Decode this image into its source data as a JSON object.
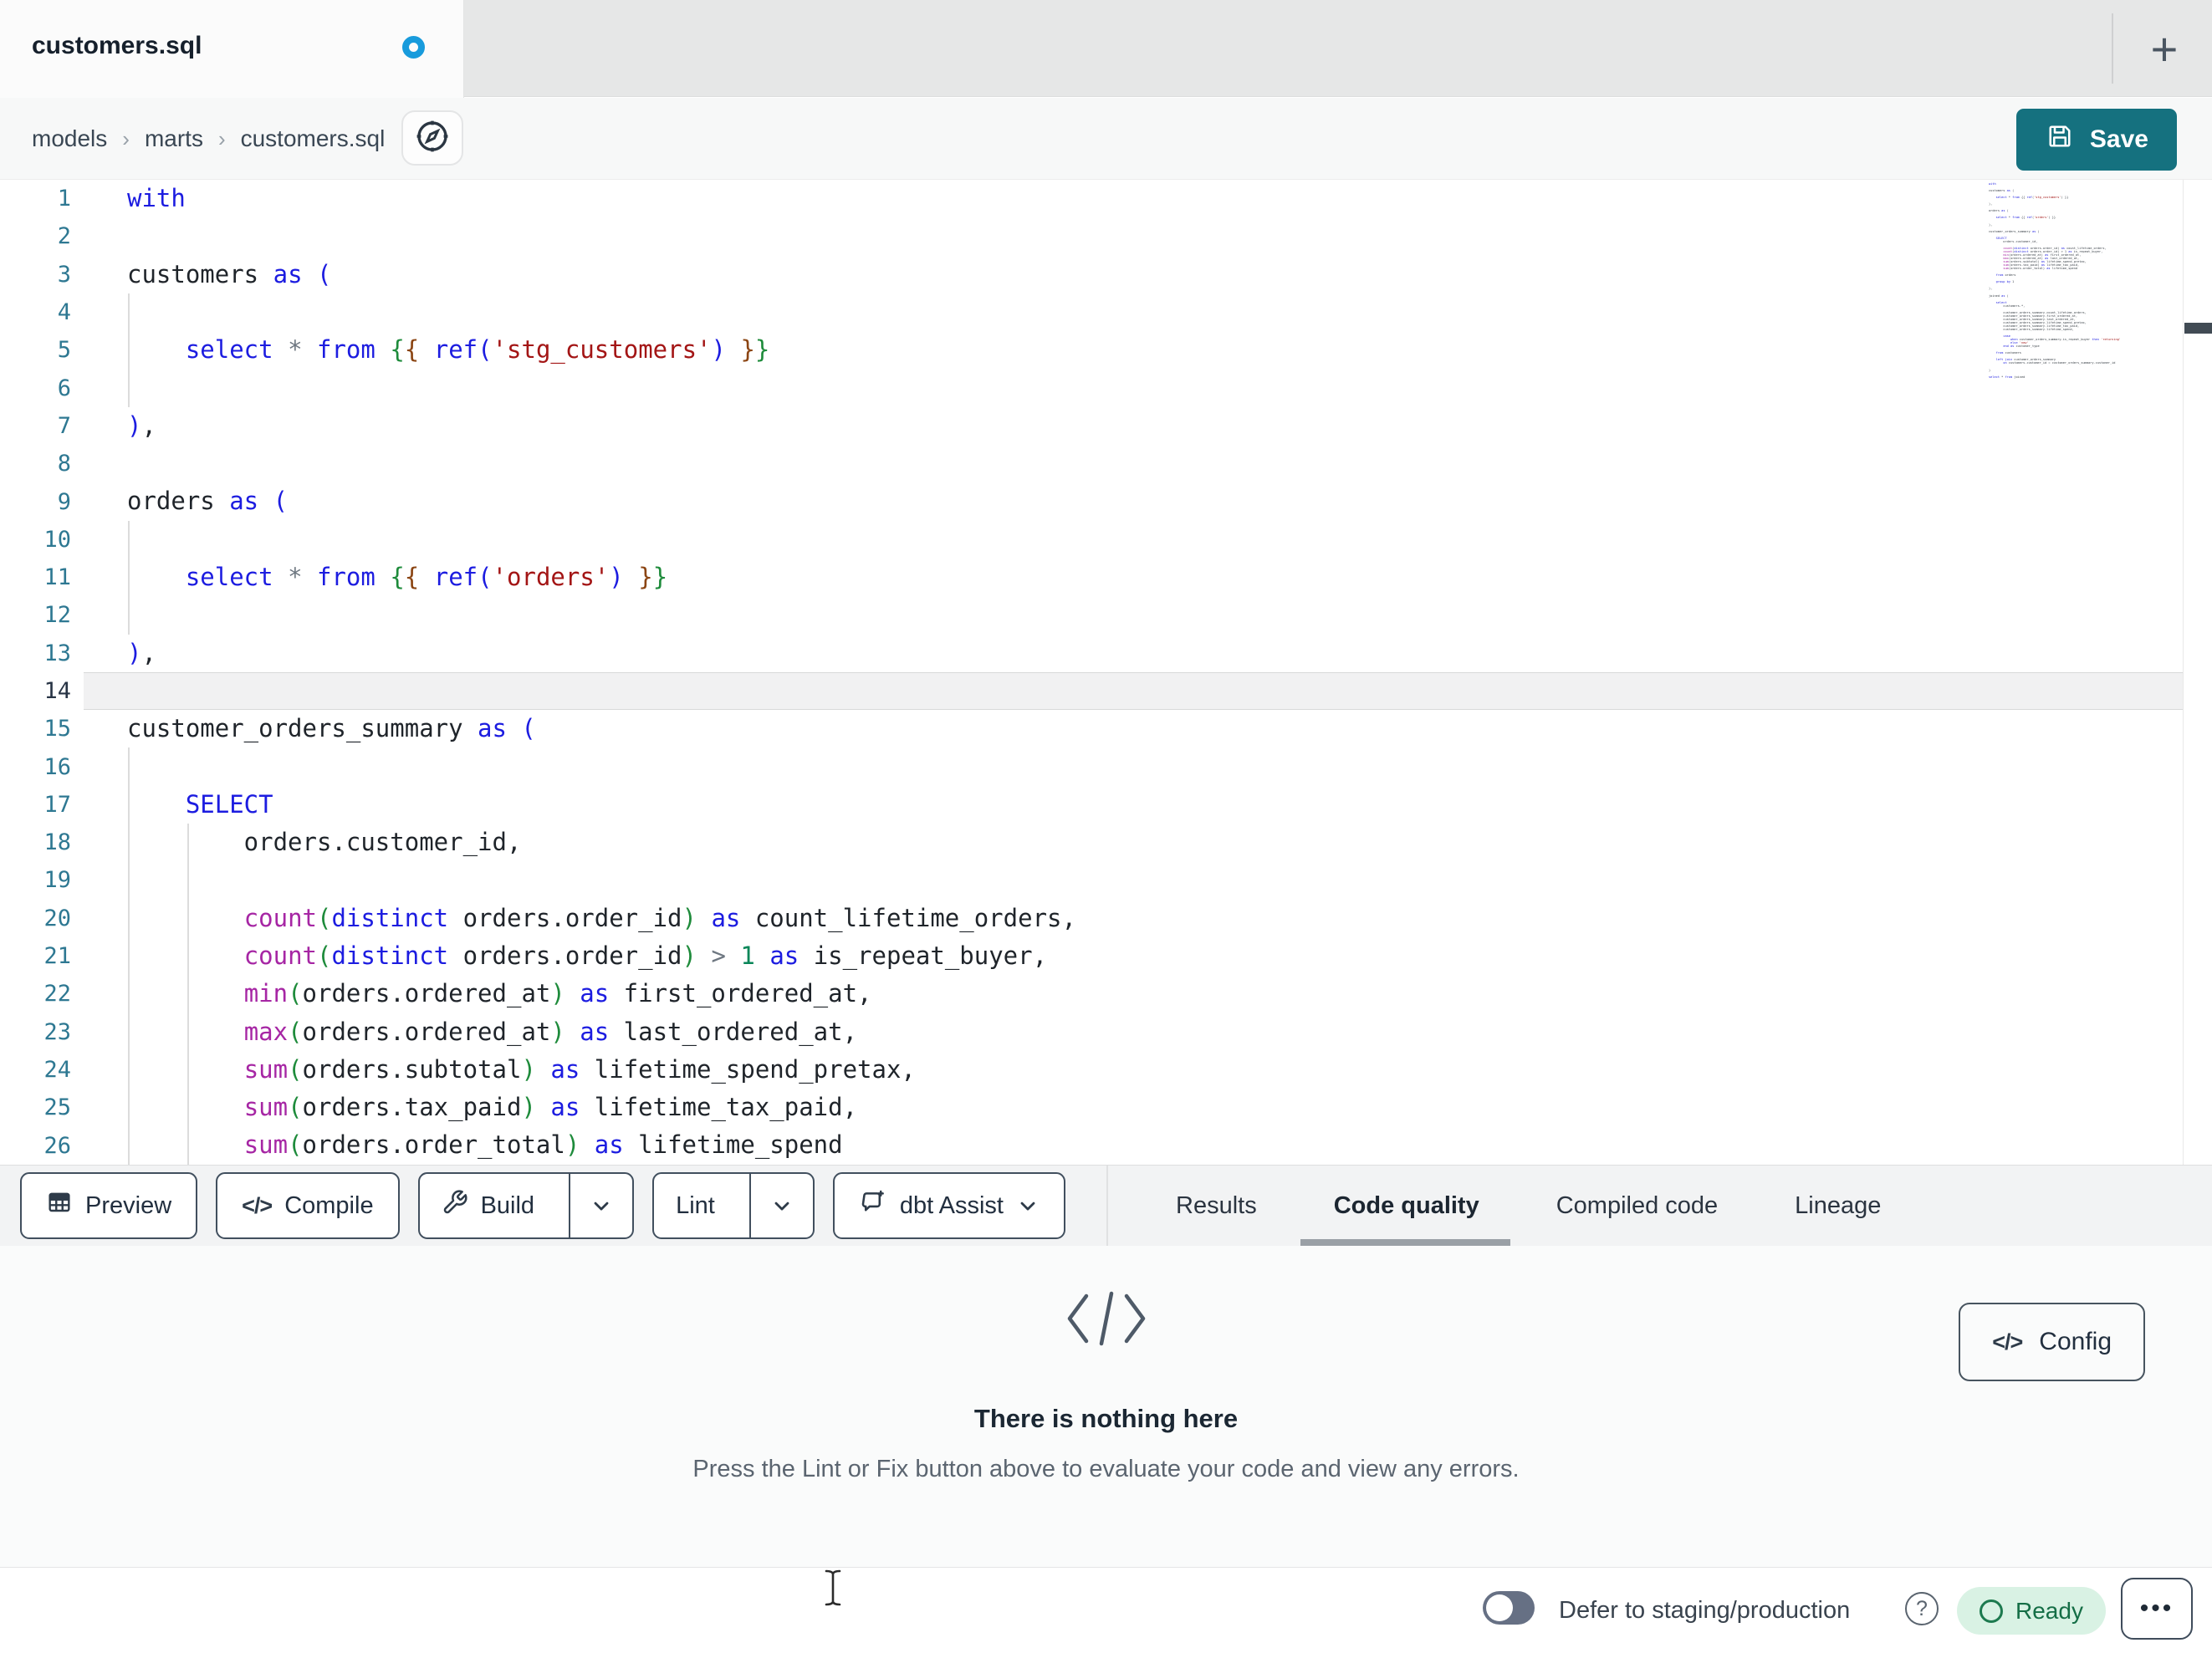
{
  "tab": {
    "title": "customers.sql",
    "unsaved_indicator": "unsaved-changes-dot"
  },
  "breadcrumb": {
    "items": [
      "models",
      "marts",
      "customers.sql"
    ],
    "separator": "›"
  },
  "save": {
    "label": "Save"
  },
  "icons": {
    "plus_glyph": "+",
    "help_glyph": "?",
    "more_glyph": "•••",
    "code_glyph": "</>",
    "save": "floppy-icon",
    "breadcrumb_action": "compass-icon",
    "preview": "table-grid-icon",
    "compile": "code-brackets-icon",
    "build": "wrench-icon",
    "assist": "chat-sparkle-icon",
    "dropdown": "chevron-down-icon",
    "empty_state": "code-brackets-icon",
    "ready": "circle-outline-icon",
    "pointer": "i-beam-cursor"
  },
  "colors": {
    "accent_teal": "#15717f",
    "unsaved_dot_blue": "#189bdc",
    "active_tab_underline": "#9aa0a6",
    "ready_badge_bg": "#d9f2e4",
    "ready_badge_text": "#156e46",
    "keyword_blue": "#1c1ce0",
    "function_magenta": "#a626a4",
    "string_red": "#a31515",
    "number_green": "#098658"
  },
  "editor": {
    "active_line": 14,
    "lines": [
      {
        "n": 1,
        "g": [],
        "t": [
          [
            "with",
            "kw"
          ]
        ]
      },
      {
        "n": 2,
        "g": [],
        "t": []
      },
      {
        "n": 3,
        "g": [],
        "t": [
          [
            "customers ",
            "id"
          ],
          [
            "as",
            "kw"
          ],
          [
            " ",
            "id"
          ],
          [
            "(",
            "b1"
          ]
        ]
      },
      {
        "n": 4,
        "g": [
          0
        ],
        "t": []
      },
      {
        "n": 5,
        "g": [
          0
        ],
        "t": [
          [
            "    ",
            "id"
          ],
          [
            "select",
            "kw"
          ],
          [
            " ",
            "id"
          ],
          [
            "*",
            "op"
          ],
          [
            " ",
            "id"
          ],
          [
            "from",
            "kw"
          ],
          [
            " ",
            "id"
          ],
          [
            "{",
            "bg"
          ],
          [
            "{",
            "bb"
          ],
          [
            " ",
            "id"
          ],
          [
            "ref",
            "kw"
          ],
          [
            "(",
            "b1"
          ],
          [
            "'stg_customers'",
            "str"
          ],
          [
            ")",
            "b1"
          ],
          [
            " ",
            "id"
          ],
          [
            "}",
            "bb"
          ],
          [
            "}",
            "bg"
          ]
        ]
      },
      {
        "n": 6,
        "g": [
          0
        ],
        "t": []
      },
      {
        "n": 7,
        "g": [],
        "t": [
          [
            ")",
            "b1"
          ],
          [
            ",",
            "id"
          ]
        ]
      },
      {
        "n": 8,
        "g": [],
        "t": []
      },
      {
        "n": 9,
        "g": [],
        "t": [
          [
            "orders ",
            "id"
          ],
          [
            "as",
            "kw"
          ],
          [
            " ",
            "id"
          ],
          [
            "(",
            "b1"
          ]
        ]
      },
      {
        "n": 10,
        "g": [
          0
        ],
        "t": []
      },
      {
        "n": 11,
        "g": [
          0
        ],
        "t": [
          [
            "    ",
            "id"
          ],
          [
            "select",
            "kw"
          ],
          [
            " ",
            "id"
          ],
          [
            "*",
            "op"
          ],
          [
            " ",
            "id"
          ],
          [
            "from",
            "kw"
          ],
          [
            " ",
            "id"
          ],
          [
            "{",
            "bg"
          ],
          [
            "{",
            "bb"
          ],
          [
            " ",
            "id"
          ],
          [
            "ref",
            "kw"
          ],
          [
            "(",
            "b1"
          ],
          [
            "'orders'",
            "str"
          ],
          [
            ")",
            "b1"
          ],
          [
            " ",
            "id"
          ],
          [
            "}",
            "bb"
          ],
          [
            "}",
            "bg"
          ]
        ]
      },
      {
        "n": 12,
        "g": [
          0
        ],
        "t": []
      },
      {
        "n": 13,
        "g": [],
        "t": [
          [
            ")",
            "b1"
          ],
          [
            ",",
            "id"
          ]
        ]
      },
      {
        "n": 14,
        "g": [],
        "t": []
      },
      {
        "n": 15,
        "g": [],
        "t": [
          [
            "customer_orders_summary ",
            "id"
          ],
          [
            "as",
            "kw"
          ],
          [
            " ",
            "id"
          ],
          [
            "(",
            "b1"
          ]
        ]
      },
      {
        "n": 16,
        "g": [
          0
        ],
        "t": []
      },
      {
        "n": 17,
        "g": [
          0
        ],
        "t": [
          [
            "    ",
            "id"
          ],
          [
            "SELECT",
            "kw"
          ]
        ]
      },
      {
        "n": 18,
        "g": [
          0,
          1
        ],
        "t": [
          [
            "        orders.customer_id,",
            "id"
          ]
        ]
      },
      {
        "n": 19,
        "g": [
          0,
          1
        ],
        "t": []
      },
      {
        "n": 20,
        "g": [
          0,
          1
        ],
        "t": [
          [
            "        ",
            "id"
          ],
          [
            "count",
            "fn"
          ],
          [
            "(",
            "bg"
          ],
          [
            "distinct",
            "kw"
          ],
          [
            " orders.order_id",
            "id"
          ],
          [
            ")",
            "bg"
          ],
          [
            " ",
            "id"
          ],
          [
            "as",
            "kw"
          ],
          [
            " count_lifetime_orders,",
            "id"
          ]
        ]
      },
      {
        "n": 21,
        "g": [
          0,
          1
        ],
        "t": [
          [
            "        ",
            "id"
          ],
          [
            "count",
            "fn"
          ],
          [
            "(",
            "bg"
          ],
          [
            "distinct",
            "kw"
          ],
          [
            " orders.order_id",
            "id"
          ],
          [
            ")",
            "bg"
          ],
          [
            " ",
            "id"
          ],
          [
            ">",
            "op"
          ],
          [
            " ",
            "id"
          ],
          [
            "1",
            "num"
          ],
          [
            " ",
            "id"
          ],
          [
            "as",
            "kw"
          ],
          [
            " is_repeat_buyer,",
            "id"
          ]
        ]
      },
      {
        "n": 22,
        "g": [
          0,
          1
        ],
        "t": [
          [
            "        ",
            "id"
          ],
          [
            "min",
            "fn"
          ],
          [
            "(",
            "bg"
          ],
          [
            "orders.ordered_at",
            "id"
          ],
          [
            ")",
            "bg"
          ],
          [
            " ",
            "id"
          ],
          [
            "as",
            "kw"
          ],
          [
            " first_ordered_at,",
            "id"
          ]
        ]
      },
      {
        "n": 23,
        "g": [
          0,
          1
        ],
        "t": [
          [
            "        ",
            "id"
          ],
          [
            "max",
            "fn"
          ],
          [
            "(",
            "bg"
          ],
          [
            "orders.ordered_at",
            "id"
          ],
          [
            ")",
            "bg"
          ],
          [
            " ",
            "id"
          ],
          [
            "as",
            "kw"
          ],
          [
            " last_ordered_at,",
            "id"
          ]
        ]
      },
      {
        "n": 24,
        "g": [
          0,
          1
        ],
        "t": [
          [
            "        ",
            "id"
          ],
          [
            "sum",
            "fn"
          ],
          [
            "(",
            "bg"
          ],
          [
            "orders.subtotal",
            "id"
          ],
          [
            ")",
            "bg"
          ],
          [
            " ",
            "id"
          ],
          [
            "as",
            "kw"
          ],
          [
            " lifetime_spend_pretax,",
            "id"
          ]
        ]
      },
      {
        "n": 25,
        "g": [
          0,
          1
        ],
        "t": [
          [
            "        ",
            "id"
          ],
          [
            "sum",
            "fn"
          ],
          [
            "(",
            "bg"
          ],
          [
            "orders.tax_paid",
            "id"
          ],
          [
            ")",
            "bg"
          ],
          [
            " ",
            "id"
          ],
          [
            "as",
            "kw"
          ],
          [
            " lifetime_tax_paid,",
            "id"
          ]
        ]
      },
      {
        "n": 26,
        "g": [
          0,
          1
        ],
        "t": [
          [
            "        ",
            "id"
          ],
          [
            "sum",
            "fn"
          ],
          [
            "(",
            "bg"
          ],
          [
            "orders.order_total",
            "id"
          ],
          [
            ")",
            "bg"
          ],
          [
            " ",
            "id"
          ],
          [
            "as",
            "kw"
          ],
          [
            " lifetime_spend",
            "id"
          ]
        ]
      }
    ]
  },
  "minimap": {
    "lines": [
      "with",
      "",
      "customers as (",
      "",
      "    select * from {{ ref('stg_customers') }}",
      "",
      "),",
      "",
      "orders as (",
      "",
      "    select * from {{ ref('orders') }}",
      "",
      "),",
      "",
      "customer_orders_summary as (",
      "",
      "    SELECT",
      "        orders.customer_id,",
      "",
      "        count(distinct orders.order_id) as count_lifetime_orders,",
      "        count(distinct orders.order_id) > 1 as is_repeat_buyer,",
      "        min(orders.ordered_at) as first_ordered_at,",
      "        max(orders.ordered_at) as last_ordered_at,",
      "        sum(orders.subtotal) as lifetime_spend_pretax,",
      "        sum(orders.tax_paid) as lifetime_tax_paid,",
      "        sum(orders.order_total) as lifetime_spend",
      "",
      "    from orders",
      "",
      "    group by 1",
      "",
      "),",
      "",
      "joined as (",
      "",
      "    select",
      "        customers.*,",
      "",
      "        customer_orders_summary.count_lifetime_orders,",
      "        customer_orders_summary.first_ordered_at,",
      "        customer_orders_summary.last_ordered_at,",
      "        customer_orders_summary.lifetime_spend_pretax,",
      "        customer_orders_summary.lifetime_tax_paid,",
      "        customer_orders_summary.lifetime_spend,",
      "",
      "        case",
      "            when customer_orders_summary.is_repeat_buyer then 'returning'",
      "            else 'new'",
      "        end as customer_type",
      "",
      "    from customers",
      "",
      "    left join customer_orders_summary",
      "        on customers.customer_id = customer_orders_summary.customer_id",
      "",
      ")",
      "",
      "select * from joined"
    ]
  },
  "toolbar": {
    "preview_label": "Preview",
    "compile_label": "Compile",
    "build_label": "Build",
    "lint_label": "Lint",
    "assist_label": "dbt Assist"
  },
  "tabs": {
    "items": [
      "Results",
      "Code quality",
      "Compiled code",
      "Lineage"
    ],
    "active": "Code quality"
  },
  "panel": {
    "empty_title": "There is nothing here",
    "empty_subtitle": "Press the Lint or Fix button above to evaluate your code and view any errors.",
    "config_label": "Config"
  },
  "statusbar": {
    "defer_label": "Defer to staging/production",
    "defer_toggle_state": "off",
    "ready_label": "Ready"
  }
}
